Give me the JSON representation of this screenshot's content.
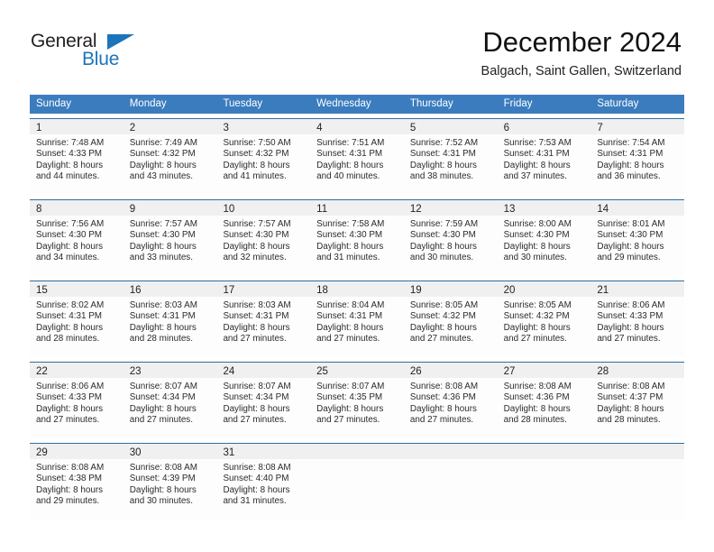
{
  "brand": {
    "name_part1": "General",
    "name_part2": "Blue",
    "color_primary": "#1b75bb",
    "color_text": "#231f20"
  },
  "header": {
    "month_title": "December 2024",
    "location": "Balgach, Saint Gallen, Switzerland"
  },
  "theme": {
    "header_blue": "#3b7cbe",
    "row_border_blue": "#2e6da4",
    "daynum_band": "#f0f0f0",
    "cell_background": "#fdfdfd"
  },
  "weekdays": [
    "Sunday",
    "Monday",
    "Tuesday",
    "Wednesday",
    "Thursday",
    "Friday",
    "Saturday"
  ],
  "weeks": [
    [
      {
        "day": "1",
        "sunrise": "Sunrise: 7:48 AM",
        "sunset": "Sunset: 4:33 PM",
        "daylight1": "Daylight: 8 hours",
        "daylight2": "and 44 minutes."
      },
      {
        "day": "2",
        "sunrise": "Sunrise: 7:49 AM",
        "sunset": "Sunset: 4:32 PM",
        "daylight1": "Daylight: 8 hours",
        "daylight2": "and 43 minutes."
      },
      {
        "day": "3",
        "sunrise": "Sunrise: 7:50 AM",
        "sunset": "Sunset: 4:32 PM",
        "daylight1": "Daylight: 8 hours",
        "daylight2": "and 41 minutes."
      },
      {
        "day": "4",
        "sunrise": "Sunrise: 7:51 AM",
        "sunset": "Sunset: 4:31 PM",
        "daylight1": "Daylight: 8 hours",
        "daylight2": "and 40 minutes."
      },
      {
        "day": "5",
        "sunrise": "Sunrise: 7:52 AM",
        "sunset": "Sunset: 4:31 PM",
        "daylight1": "Daylight: 8 hours",
        "daylight2": "and 38 minutes."
      },
      {
        "day": "6",
        "sunrise": "Sunrise: 7:53 AM",
        "sunset": "Sunset: 4:31 PM",
        "daylight1": "Daylight: 8 hours",
        "daylight2": "and 37 minutes."
      },
      {
        "day": "7",
        "sunrise": "Sunrise: 7:54 AM",
        "sunset": "Sunset: 4:31 PM",
        "daylight1": "Daylight: 8 hours",
        "daylight2": "and 36 minutes."
      }
    ],
    [
      {
        "day": "8",
        "sunrise": "Sunrise: 7:56 AM",
        "sunset": "Sunset: 4:30 PM",
        "daylight1": "Daylight: 8 hours",
        "daylight2": "and 34 minutes."
      },
      {
        "day": "9",
        "sunrise": "Sunrise: 7:57 AM",
        "sunset": "Sunset: 4:30 PM",
        "daylight1": "Daylight: 8 hours",
        "daylight2": "and 33 minutes."
      },
      {
        "day": "10",
        "sunrise": "Sunrise: 7:57 AM",
        "sunset": "Sunset: 4:30 PM",
        "daylight1": "Daylight: 8 hours",
        "daylight2": "and 32 minutes."
      },
      {
        "day": "11",
        "sunrise": "Sunrise: 7:58 AM",
        "sunset": "Sunset: 4:30 PM",
        "daylight1": "Daylight: 8 hours",
        "daylight2": "and 31 minutes."
      },
      {
        "day": "12",
        "sunrise": "Sunrise: 7:59 AM",
        "sunset": "Sunset: 4:30 PM",
        "daylight1": "Daylight: 8 hours",
        "daylight2": "and 30 minutes."
      },
      {
        "day": "13",
        "sunrise": "Sunrise: 8:00 AM",
        "sunset": "Sunset: 4:30 PM",
        "daylight1": "Daylight: 8 hours",
        "daylight2": "and 30 minutes."
      },
      {
        "day": "14",
        "sunrise": "Sunrise: 8:01 AM",
        "sunset": "Sunset: 4:30 PM",
        "daylight1": "Daylight: 8 hours",
        "daylight2": "and 29 minutes."
      }
    ],
    [
      {
        "day": "15",
        "sunrise": "Sunrise: 8:02 AM",
        "sunset": "Sunset: 4:31 PM",
        "daylight1": "Daylight: 8 hours",
        "daylight2": "and 28 minutes."
      },
      {
        "day": "16",
        "sunrise": "Sunrise: 8:03 AM",
        "sunset": "Sunset: 4:31 PM",
        "daylight1": "Daylight: 8 hours",
        "daylight2": "and 28 minutes."
      },
      {
        "day": "17",
        "sunrise": "Sunrise: 8:03 AM",
        "sunset": "Sunset: 4:31 PM",
        "daylight1": "Daylight: 8 hours",
        "daylight2": "and 27 minutes."
      },
      {
        "day": "18",
        "sunrise": "Sunrise: 8:04 AM",
        "sunset": "Sunset: 4:31 PM",
        "daylight1": "Daylight: 8 hours",
        "daylight2": "and 27 minutes."
      },
      {
        "day": "19",
        "sunrise": "Sunrise: 8:05 AM",
        "sunset": "Sunset: 4:32 PM",
        "daylight1": "Daylight: 8 hours",
        "daylight2": "and 27 minutes."
      },
      {
        "day": "20",
        "sunrise": "Sunrise: 8:05 AM",
        "sunset": "Sunset: 4:32 PM",
        "daylight1": "Daylight: 8 hours",
        "daylight2": "and 27 minutes."
      },
      {
        "day": "21",
        "sunrise": "Sunrise: 8:06 AM",
        "sunset": "Sunset: 4:33 PM",
        "daylight1": "Daylight: 8 hours",
        "daylight2": "and 27 minutes."
      }
    ],
    [
      {
        "day": "22",
        "sunrise": "Sunrise: 8:06 AM",
        "sunset": "Sunset: 4:33 PM",
        "daylight1": "Daylight: 8 hours",
        "daylight2": "and 27 minutes."
      },
      {
        "day": "23",
        "sunrise": "Sunrise: 8:07 AM",
        "sunset": "Sunset: 4:34 PM",
        "daylight1": "Daylight: 8 hours",
        "daylight2": "and 27 minutes."
      },
      {
        "day": "24",
        "sunrise": "Sunrise: 8:07 AM",
        "sunset": "Sunset: 4:34 PM",
        "daylight1": "Daylight: 8 hours",
        "daylight2": "and 27 minutes."
      },
      {
        "day": "25",
        "sunrise": "Sunrise: 8:07 AM",
        "sunset": "Sunset: 4:35 PM",
        "daylight1": "Daylight: 8 hours",
        "daylight2": "and 27 minutes."
      },
      {
        "day": "26",
        "sunrise": "Sunrise: 8:08 AM",
        "sunset": "Sunset: 4:36 PM",
        "daylight1": "Daylight: 8 hours",
        "daylight2": "and 27 minutes."
      },
      {
        "day": "27",
        "sunrise": "Sunrise: 8:08 AM",
        "sunset": "Sunset: 4:36 PM",
        "daylight1": "Daylight: 8 hours",
        "daylight2": "and 28 minutes."
      },
      {
        "day": "28",
        "sunrise": "Sunrise: 8:08 AM",
        "sunset": "Sunset: 4:37 PM",
        "daylight1": "Daylight: 8 hours",
        "daylight2": "and 28 minutes."
      }
    ],
    [
      {
        "day": "29",
        "sunrise": "Sunrise: 8:08 AM",
        "sunset": "Sunset: 4:38 PM",
        "daylight1": "Daylight: 8 hours",
        "daylight2": "and 29 minutes."
      },
      {
        "day": "30",
        "sunrise": "Sunrise: 8:08 AM",
        "sunset": "Sunset: 4:39 PM",
        "daylight1": "Daylight: 8 hours",
        "daylight2": "and 30 minutes."
      },
      {
        "day": "31",
        "sunrise": "Sunrise: 8:08 AM",
        "sunset": "Sunset: 4:40 PM",
        "daylight1": "Daylight: 8 hours",
        "daylight2": "and 31 minutes."
      },
      {
        "day": "",
        "sunrise": "",
        "sunset": "",
        "daylight1": "",
        "daylight2": ""
      },
      {
        "day": "",
        "sunrise": "",
        "sunset": "",
        "daylight1": "",
        "daylight2": ""
      },
      {
        "day": "",
        "sunrise": "",
        "sunset": "",
        "daylight1": "",
        "daylight2": ""
      },
      {
        "day": "",
        "sunrise": "",
        "sunset": "",
        "daylight1": "",
        "daylight2": ""
      }
    ]
  ]
}
